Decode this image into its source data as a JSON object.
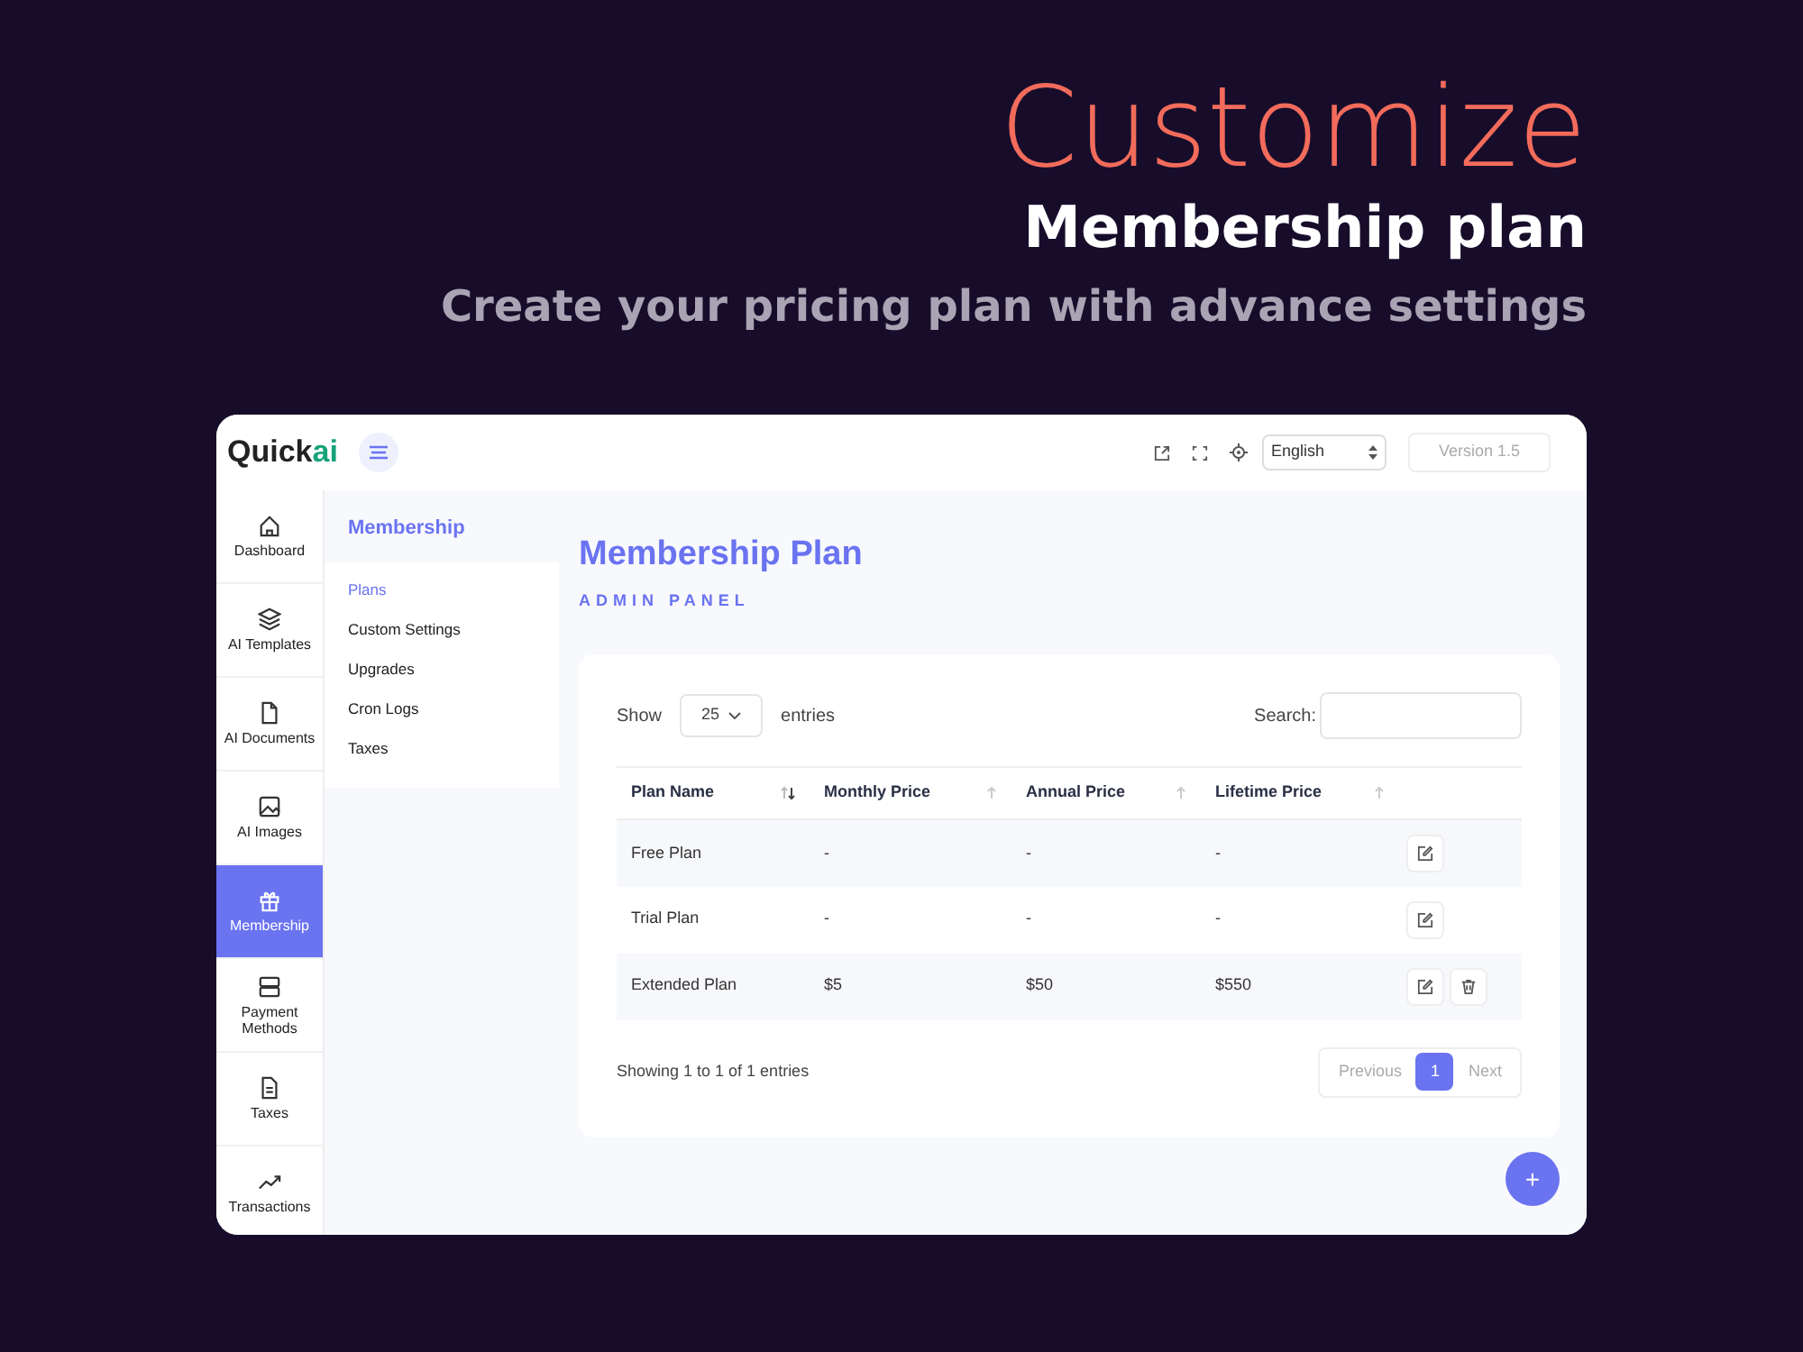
{
  "headline": {
    "title": "Customize",
    "subtitle": "Membership plan",
    "tagline": "Create your pricing plan with advance settings"
  },
  "app": {
    "logo_text": "Quick",
    "logo_accent": "ai",
    "language": "English",
    "version": "Version 1.5"
  },
  "sidebar": {
    "items": [
      {
        "label": "Dashboard",
        "selected": false
      },
      {
        "label": "AI Templates",
        "selected": false
      },
      {
        "label": "AI Documents",
        "selected": false
      },
      {
        "label": "AI Images",
        "selected": false
      },
      {
        "label": "Membership",
        "selected": true
      },
      {
        "label": "Payment Methods",
        "selected": false
      },
      {
        "label": "Taxes",
        "selected": false
      },
      {
        "label": "Transactions",
        "selected": false
      }
    ]
  },
  "submenu": {
    "title": "Membership",
    "items": [
      {
        "label": "Plans",
        "selected": true
      },
      {
        "label": "Custom Settings",
        "selected": false
      },
      {
        "label": "Upgrades",
        "selected": false
      },
      {
        "label": "Cron Logs",
        "selected": false
      },
      {
        "label": "Taxes",
        "selected": false
      }
    ]
  },
  "page": {
    "title": "Membership Plan",
    "subtitle": "ADMIN PANEL"
  },
  "table_controls": {
    "show_label": "Show",
    "page_size": "25",
    "entries_label": "entries",
    "search_label": "Search:"
  },
  "table": {
    "columns": [
      "Plan Name",
      "Monthly Price",
      "Annual Price",
      "Lifetime Price"
    ],
    "rows": [
      {
        "cells": [
          "Free Plan",
          "-",
          "-",
          "-"
        ],
        "deletable": false
      },
      {
        "cells": [
          "Trial Plan",
          "-",
          "-",
          "-"
        ],
        "deletable": false
      },
      {
        "cells": [
          "Extended Plan",
          "$5",
          "$50",
          "$550"
        ],
        "deletable": true
      }
    ]
  },
  "footer": {
    "info": "Showing 1 to 1 of 1 entries",
    "previous": "Previous",
    "pages": [
      {
        "label": "1",
        "selected": true
      }
    ],
    "next": "Next"
  },
  "fab": {
    "label": "+"
  }
}
